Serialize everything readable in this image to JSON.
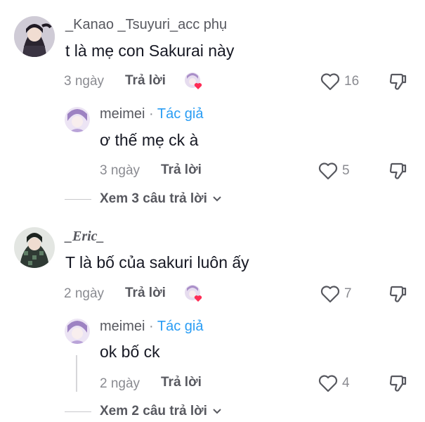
{
  "comments": [
    {
      "author": "_Kanao _Tsuyuri_acc phụ",
      "text": "t là mẹ con Sakurai này",
      "time": "3 ngày",
      "reply_label": "Trả lời",
      "likes": "16",
      "reply": {
        "author": "meimei",
        "separator": " · ",
        "badge": "Tác giả",
        "text": "ơ thế mẹ ck à",
        "time": "3 ngày",
        "reply_label": "Trả lời",
        "likes": "5"
      },
      "view_more": "Xem 3 câu trả lời"
    },
    {
      "author": "_Eric_",
      "text": "T là bố của sakuri luôn ấy",
      "time": "2 ngày",
      "reply_label": "Trả lời",
      "likes": "7",
      "reply": {
        "author": "meimei",
        "separator": " · ",
        "badge": "Tác giả",
        "text": "ok bố ck",
        "time": "2 ngày",
        "reply_label": "Trả lời",
        "likes": "4"
      },
      "view_more": "Xem 2 câu trả lời"
    }
  ],
  "colors": {
    "author_badge": "#2a9df4",
    "heart_badge": "#fe2c55"
  },
  "icons": [
    "heart-icon",
    "dislike-icon",
    "chevron-down-icon",
    "liked-by-creator-icon"
  ]
}
